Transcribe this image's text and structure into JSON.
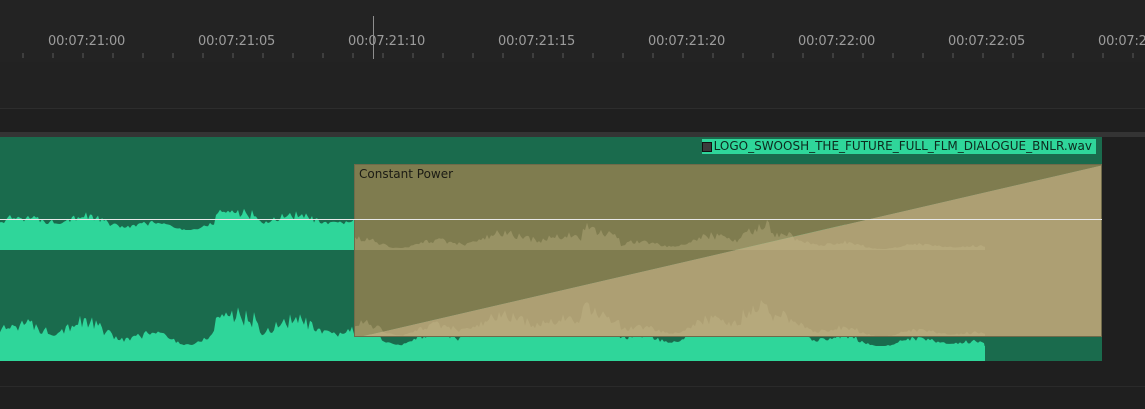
{
  "ruler": {
    "timecodes": [
      "00:07:21:00",
      "00:07:21:05",
      "00:07:21:10",
      "00:07:21:15",
      "00:07:21:20",
      "00:07:22:00",
      "00:07:22:05",
      "00:07:2"
    ]
  },
  "clip": {
    "file_name": "LOGO_SWOOSH_THE_FUTURE_FULL_FLM_DIALOGUE_BNLR",
    "extension": ".wav",
    "color": "#1a6b4d",
    "waveform_color": "#2fd69a"
  },
  "transition": {
    "label": "Constant Power",
    "color": "#b1a574"
  }
}
